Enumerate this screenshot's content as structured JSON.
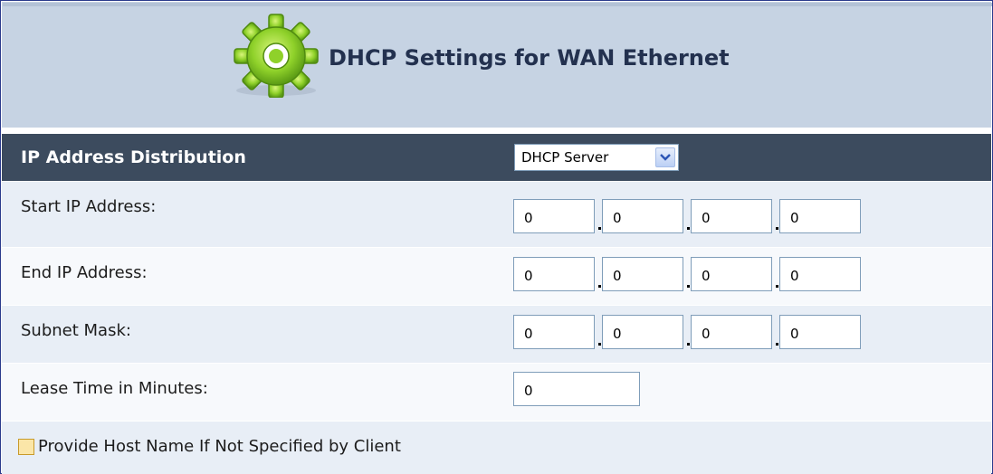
{
  "header": {
    "title": "DHCP Settings for WAN Ethernet",
    "icon": "gear-icon"
  },
  "distribution": {
    "label": "IP Address Distribution",
    "selected": "DHCP Server"
  },
  "fields": {
    "start_ip": {
      "label": "Start IP Address:",
      "octets": [
        "0",
        "0",
        "0",
        "0"
      ]
    },
    "end_ip": {
      "label": "End IP Address:",
      "octets": [
        "0",
        "0",
        "0",
        "0"
      ]
    },
    "subnet_mask": {
      "label": "Subnet Mask:",
      "octets": [
        "0",
        "0",
        "0",
        "0"
      ]
    },
    "lease_time": {
      "label": "Lease Time in Minutes:",
      "value": "0"
    }
  },
  "provide_host_name": {
    "label": "Provide Host Name If Not Specified by Client",
    "checked": false
  },
  "colors": {
    "header_bg": "#c6d3e3",
    "title_text": "#23314f",
    "dark_row": "#3c4b5e",
    "row_alt_a": "#e8eef6",
    "row_alt_b": "#f7f9fc",
    "gear_green": "#8fd12a"
  }
}
